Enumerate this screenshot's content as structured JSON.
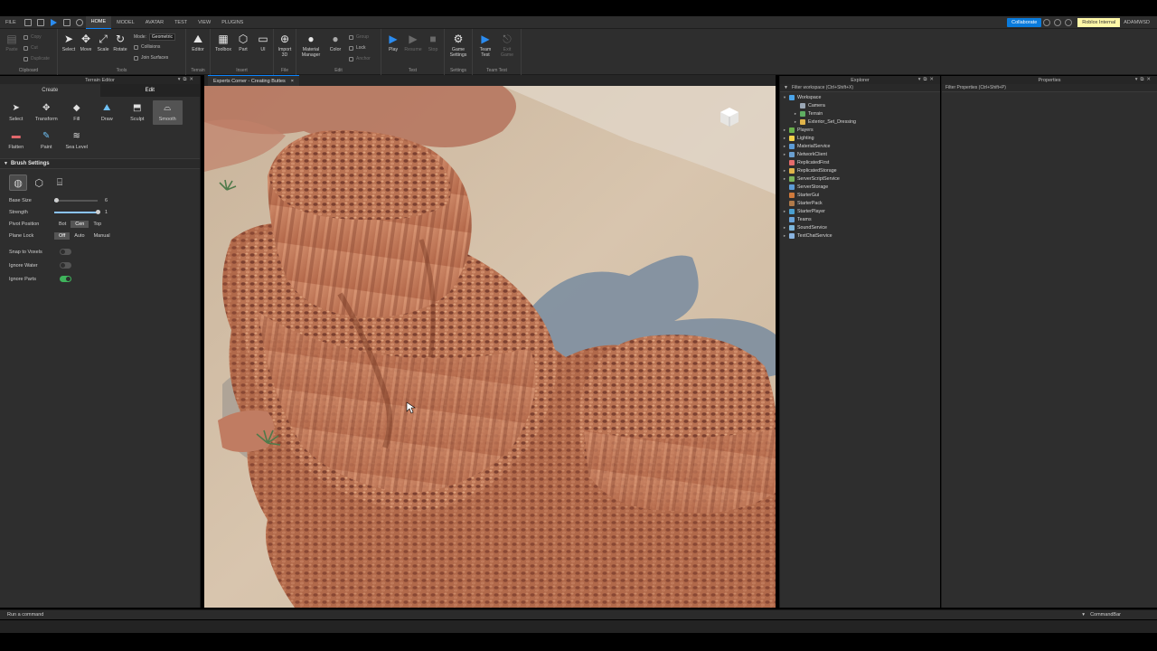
{
  "menubar": {
    "file": "FILE",
    "tabs": [
      "HOME",
      "MODEL",
      "AVATAR",
      "TEST",
      "VIEW",
      "PLUGINS"
    ],
    "active_tab": "HOME",
    "collaborate": "Collaborate",
    "internal_badge": "Roblox Internal",
    "username": "ADAMWSD"
  },
  "ribbon": {
    "clipboard": {
      "paste": "Paste",
      "copy": "Copy",
      "cut": "Cut",
      "duplicate": "Duplicate",
      "label": "Clipboard"
    },
    "tools": {
      "select": "Select",
      "move": "Move",
      "scale": "Scale",
      "rotate": "Rotate",
      "mode_label": "Mode:",
      "mode_value": "Geometric",
      "collisions": "Collisions",
      "join_surfaces": "Join Surfaces",
      "label": "Tools"
    },
    "terrain": {
      "editor": "Editor",
      "label": "Terrain"
    },
    "insert": {
      "toolbox": "Toolbox",
      "part": "Part",
      "ui": "UI",
      "label": "Insert"
    },
    "file": {
      "import3d": "Import 3D",
      "label": "File"
    },
    "edit": {
      "material_manager": "Material Manager",
      "color": "Color",
      "group": "Group",
      "lock": "Lock",
      "anchor": "Anchor",
      "label": "Edit"
    },
    "test": {
      "play": "Play",
      "resume": "Resume",
      "stop": "Stop",
      "label": "Test"
    },
    "settings": {
      "game_settings": "Game Settings",
      "label": "Settings"
    },
    "team_test": {
      "team_test": "Team Test",
      "exit_game": "Exit Game",
      "label": "Team Test"
    }
  },
  "terrain_editor": {
    "title": "Terrain Editor",
    "tabs": [
      "Create",
      "Edit"
    ],
    "active_tab": "Edit",
    "tools": [
      {
        "label": "Select",
        "icon": "cursor-icon",
        "glyph": "➤",
        "tone": "",
        "selected": false
      },
      {
        "label": "Transform",
        "icon": "transform-icon",
        "glyph": "✥",
        "tone": "",
        "selected": false
      },
      {
        "label": "Fill",
        "icon": "paint-bucket-icon",
        "glyph": "◆",
        "tone": "",
        "selected": false
      },
      {
        "label": "Draw",
        "icon": "draw-icon",
        "glyph": "⛰",
        "tone": "blue",
        "selected": false
      },
      {
        "label": "Sculpt",
        "icon": "sculpt-icon",
        "glyph": "⬒",
        "tone": "",
        "selected": false
      },
      {
        "label": "Smooth",
        "icon": "smooth-icon",
        "glyph": "⌓",
        "tone": "",
        "selected": true
      },
      {
        "label": "Flatten",
        "icon": "flatten-icon",
        "glyph": "▬",
        "tone": "red",
        "selected": false
      },
      {
        "label": "Paint",
        "icon": "paint-icon",
        "glyph": "✎",
        "tone": "blue",
        "selected": false
      },
      {
        "label": "Sea Level",
        "icon": "sea-level-icon",
        "glyph": "≋",
        "tone": "",
        "selected": false
      }
    ],
    "brush_settings": {
      "title": "Brush Settings",
      "base_size_label": "Base Size",
      "base_size_value": "6",
      "base_size_fraction": 0.05,
      "strength_label": "Strength",
      "strength_value": "1",
      "strength_fraction": 1.0,
      "pivot_label": "Pivot Position",
      "pivot_options": [
        "Bot",
        "Cen",
        "Top"
      ],
      "pivot_selected": "Cen",
      "plane_lock_label": "Plane Lock",
      "plane_lock_options": [
        "Off",
        "Auto",
        "Manual"
      ],
      "plane_lock_selected": "Off",
      "snap_label": "Snap to Voxels",
      "snap_on": false,
      "ignore_water_label": "Ignore Water",
      "ignore_water_on": false,
      "ignore_parts_label": "Ignore Parts",
      "ignore_parts_on": true
    }
  },
  "viewport": {
    "tab_title": "Experts Corner - Creating Buttes",
    "close": "×"
  },
  "explorer": {
    "title": "Explorer",
    "filter_placeholder": "Filter workspace (Ctrl+Shift+X)",
    "items": [
      {
        "label": "Workspace",
        "depth": 0,
        "expand": "▾",
        "color": "#4aa3e8"
      },
      {
        "label": "Camera",
        "depth": 2,
        "expand": "",
        "color": "#9aa7b5"
      },
      {
        "label": "Terrain",
        "depth": 2,
        "expand": "▸",
        "color": "#5fae62"
      },
      {
        "label": "Exterior_Set_Dressing",
        "depth": 2,
        "expand": "▸",
        "color": "#e0b34a"
      },
      {
        "label": "Players",
        "depth": 0,
        "expand": "▸",
        "color": "#6ab04c"
      },
      {
        "label": "Lighting",
        "depth": 0,
        "expand": "▸",
        "color": "#f2d04a"
      },
      {
        "label": "MaterialService",
        "depth": 0,
        "expand": "▸",
        "color": "#5c9bd6"
      },
      {
        "label": "NetworkClient",
        "depth": 0,
        "expand": "▸",
        "color": "#6a9fd0"
      },
      {
        "label": "ReplicatedFirst",
        "depth": 0,
        "expand": "",
        "color": "#e56b6b"
      },
      {
        "label": "ReplicatedStorage",
        "depth": 0,
        "expand": "▸",
        "color": "#e0b34a"
      },
      {
        "label": "ServerScriptService",
        "depth": 0,
        "expand": "▸",
        "color": "#7ab35b"
      },
      {
        "label": "ServerStorage",
        "depth": 0,
        "expand": "",
        "color": "#5c9bd6"
      },
      {
        "label": "StarterGui",
        "depth": 0,
        "expand": "",
        "color": "#d07a3c"
      },
      {
        "label": "StarterPack",
        "depth": 0,
        "expand": "",
        "color": "#b07a4a"
      },
      {
        "label": "StarterPlayer",
        "depth": 0,
        "expand": "▸",
        "color": "#4a9fd0"
      },
      {
        "label": "Teams",
        "depth": 0,
        "expand": "",
        "color": "#6aa3d9"
      },
      {
        "label": "SoundService",
        "depth": 0,
        "expand": "▸",
        "color": "#7cb6dd"
      },
      {
        "label": "TextChatService",
        "depth": 0,
        "expand": "▸",
        "color": "#8ab4e0"
      }
    ]
  },
  "properties": {
    "title": "Properties",
    "filter_placeholder": "Filter Properties (Ctrl+Shift+P)"
  },
  "commandbar": {
    "placeholder": "Run a command",
    "label": "CommandBar"
  }
}
